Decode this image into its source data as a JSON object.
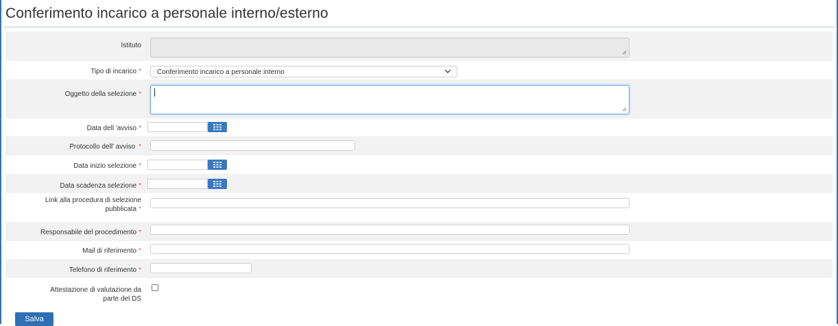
{
  "page": {
    "title": "Conferimento incarico a personale interno/esterno"
  },
  "form": {
    "required_marker": "*",
    "istituto": {
      "label": "Istituto",
      "value": ""
    },
    "tipo_incarico": {
      "label": "Tipo di incarico",
      "selected": "Conferimento incarico a personale interno",
      "chevron": "chevron-down-icon"
    },
    "oggetto": {
      "label": "Oggetto della selezione",
      "value": ""
    },
    "data_avviso": {
      "label": "Data dell 'avviso",
      "value": "",
      "calendar_icon": "calendar-icon"
    },
    "protocollo": {
      "label": "Protocollo dell' avviso",
      "value": ""
    },
    "data_inizio": {
      "label": "Data inizio selezione",
      "value": ""
    },
    "data_scadenza": {
      "label": "Data scadenza selezione",
      "value": ""
    },
    "link": {
      "label_line1": "Link alla procedura di selezione",
      "label_line2": "pubblicata",
      "value": ""
    },
    "responsabile": {
      "label": "Responsabile del procedimento",
      "value": ""
    },
    "mail": {
      "label": "Mail di riferimento",
      "value": ""
    },
    "telefono": {
      "label": "Telefono di riferimento",
      "value": ""
    },
    "attestazione": {
      "label_line1": "Attestazione di valutazione da",
      "label_line2": "parte del DS",
      "checked": false
    }
  },
  "actions": {
    "save_label": "Salva"
  },
  "colors": {
    "accent": "#2f6fb3",
    "calendar_button": "#3b78c2",
    "required": "#e05555",
    "row_shade": "#f2f2f2",
    "focus_border": "#66a3e0"
  }
}
